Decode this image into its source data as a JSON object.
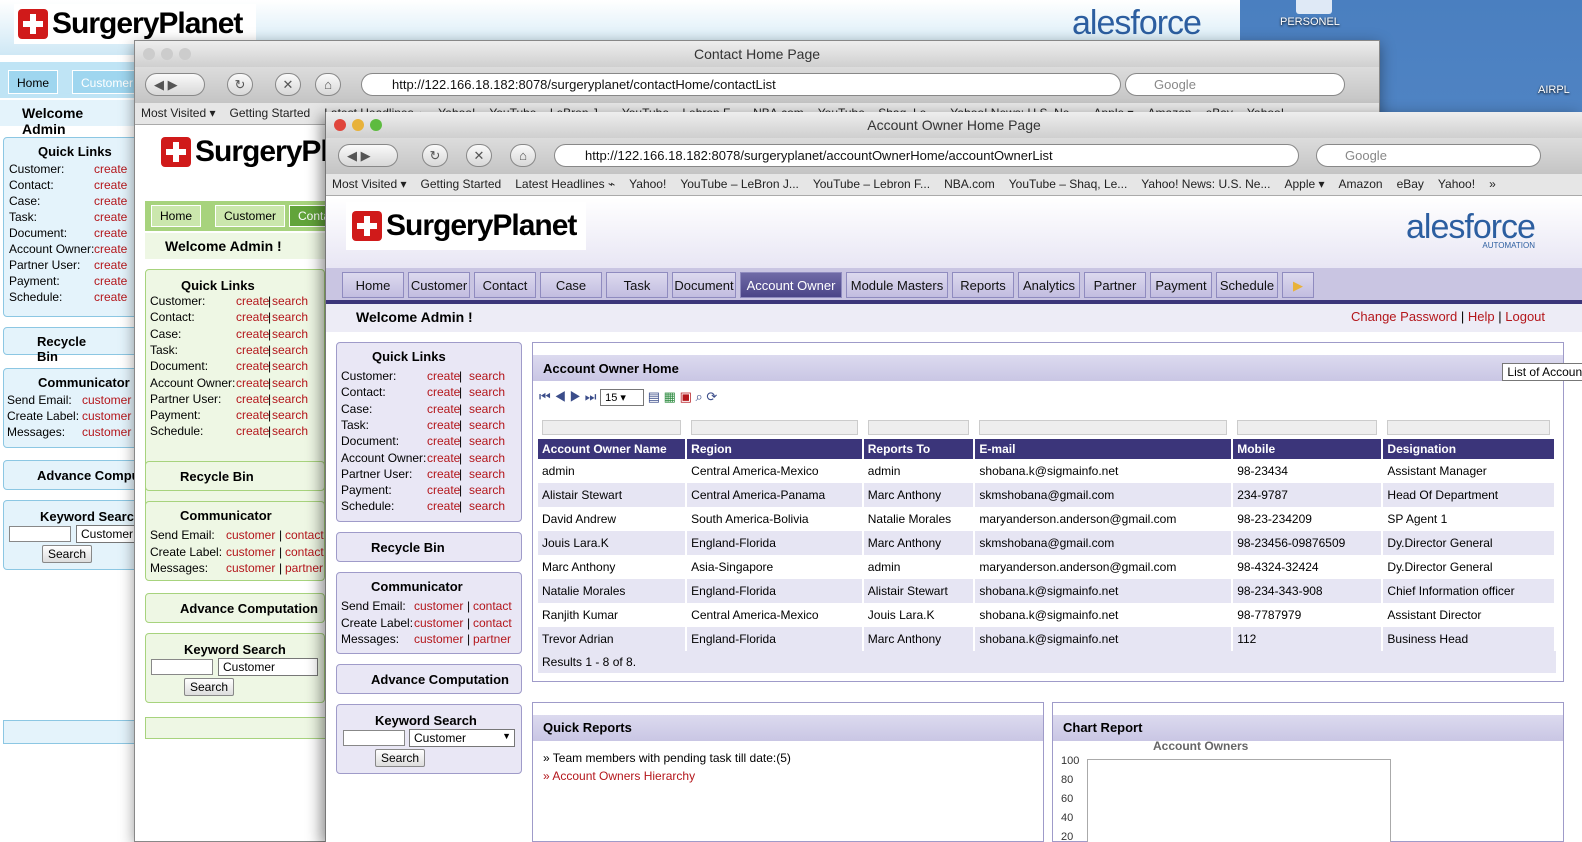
{
  "desktop": {
    "personel_label": "PERSONEL",
    "airport_label": "AIRPL"
  },
  "back_window": {
    "brand": "SurgeryPlanet",
    "sf_brand": "alesforce",
    "tabs": [
      "Home",
      "Customer"
    ],
    "welcome": "Welcome Admin",
    "quick_links_title": "Quick Links",
    "quick_links": [
      {
        "label": "Customer:",
        "action": "create"
      },
      {
        "label": "Contact:",
        "action": "create"
      },
      {
        "label": "Case:",
        "action": "create"
      },
      {
        "label": "Task:",
        "action": "create"
      },
      {
        "label": "Document:",
        "action": "create"
      },
      {
        "label": "Account Owner:",
        "action": "create"
      },
      {
        "label": "Partner User:",
        "action": "create"
      },
      {
        "label": "Payment:",
        "action": "create"
      },
      {
        "label": "Schedule:",
        "action": "create"
      }
    ],
    "recycle_bin": "Recycle Bin",
    "communicator_title": "Communicator",
    "communicator": [
      {
        "label": "Send Email:",
        "link": "customer"
      },
      {
        "label": "Create Label:",
        "link": "customer"
      },
      {
        "label": "Messages:",
        "link": "customer"
      }
    ],
    "advance": "Advance Comput",
    "keyword_title": "Keyword Search",
    "keyword_select": "Customer",
    "search_btn": "Search"
  },
  "mid_window": {
    "title": "Contact Home Page",
    "url": "http://122.166.18.182:8078/surgeryplanet/contactHome/contactList",
    "search_placeholder": "Google",
    "bookmarks": [
      "Most Visited ▾",
      "Getting Started",
      "Latest Headlines ⌁",
      "Yahoo!",
      "YouTube – LeBron J...",
      "YouTube – Lebron F...",
      "NBA.com",
      "YouTube – Shaq, Le...",
      "Yahoo! News: U.S. Ne...",
      "Apple ▾",
      "Amazon",
      "eBay",
      "Yahoo!"
    ],
    "brand": "SurgeryPla",
    "tabs": [
      "Home",
      "Customer",
      "Contac"
    ],
    "welcome": "Welcome Admin !",
    "quick_links_title": "Quick Links",
    "quick_links": [
      "Customer:",
      "Contact:",
      "Case:",
      "Task:",
      "Document:",
      "Account Owner:",
      "Partner User:",
      "Payment:",
      "Schedule:"
    ],
    "create": "create",
    "search": "search",
    "recycle_bin": "Recycle Bin",
    "communicator_title": "Communicator",
    "communicator": [
      {
        "label": "Send Email:",
        "a": "customer",
        "b": "contact"
      },
      {
        "label": "Create Label:",
        "a": "customer",
        "b": "contact"
      },
      {
        "label": "Messages:",
        "a": "customer",
        "b": "partner"
      }
    ],
    "advance": "Advance Computation",
    "keyword_title": "Keyword Search",
    "keyword_select": "Customer",
    "search_btn": "Search"
  },
  "main_window": {
    "title": "Account Owner Home Page",
    "url": "http://122.166.18.182:8078/surgeryplanet/accountOwnerHome/accountOwnerList",
    "search_placeholder": "Google",
    "bookmarks": [
      "Most Visited ▾",
      "Getting Started",
      "Latest Headlines ⌁",
      "Yahoo!",
      "YouTube – LeBron J...",
      "YouTube – Lebron F...",
      "NBA.com",
      "YouTube – Shaq, Le...",
      "Yahoo! News: U.S. Ne...",
      "Apple ▾",
      "Amazon",
      "eBay",
      "Yahoo!",
      "»"
    ],
    "brand": "SurgeryPlanet",
    "sf_brand": "alesforce",
    "sf_sub": "AUTOMATION",
    "tabs": [
      "Home",
      "Customer",
      "Contact",
      "Case",
      "Task",
      "Document",
      "Account Owner",
      "Module Masters",
      "Reports",
      "Analytics",
      "Partner",
      "Payment",
      "Schedule"
    ],
    "active_tab": "Account Owner",
    "welcome": "Welcome Admin !",
    "top_links": {
      "change_password": "Change Password",
      "help": "Help",
      "logout": "Logout",
      "sep": "|"
    },
    "quick_links_title": "Quick Links",
    "quick_links": [
      "Customer:",
      "Contact:",
      "Case:",
      "Task:",
      "Document:",
      "Account Owner:",
      "Partner User:",
      "Payment:",
      "Schedule:"
    ],
    "create": "create",
    "search": "search",
    "sep": "|",
    "recycle_bin": "Recycle Bin",
    "communicator_title": "Communicator",
    "communicator": [
      {
        "label": "Send Email:",
        "a": "customer",
        "b": "contact"
      },
      {
        "label": "Create Label:",
        "a": "customer",
        "b": "contact"
      },
      {
        "label": "Messages:",
        "a": "customer",
        "b": "partner"
      }
    ],
    "advance": "Advance Computation",
    "keyword_title": "Keyword Search",
    "keyword_select": "Customer",
    "search_btn": "Search",
    "grid_panel_title": "Account Owner Home",
    "list_select": "List of Account Owners",
    "page_size": "15",
    "columns": [
      "Account Owner Name",
      "Region",
      "Reports To",
      "E-mail",
      "Mobile",
      "Designation"
    ],
    "rows": [
      [
        "admin",
        "Central America-Mexico",
        "admin",
        "shobana.k@sigmainfo.net",
        "98-23434",
        "Assistant Manager"
      ],
      [
        "Alistair Stewart",
        "Central America-Panama",
        "Marc Anthony",
        "skmshobana@gmail.com",
        "234-9787",
        "Head Of Department"
      ],
      [
        "David Andrew",
        "South America-Bolivia",
        "Natalie Morales",
        "maryanderson.anderson@gmail.com",
        "98-23-234209",
        "SP Agent 1"
      ],
      [
        "Jouis Lara.K",
        "England-Florida",
        "Marc Anthony",
        "skmshobana@gmail.com",
        "98-23456-09876509",
        "Dy.Director General"
      ],
      [
        "Marc Anthony",
        "Asia-Singapore",
        "admin",
        "maryanderson.anderson@gmail.com",
        "98-4324-32424",
        "Dy.Director General"
      ],
      [
        "Natalie Morales",
        "England-Florida",
        "Alistair Stewart",
        "shobana.k@sigmainfo.net",
        "98-234-343-908",
        "Chief Information officer"
      ],
      [
        "Ranjith Kumar",
        "Central America-Mexico",
        "Jouis Lara.K",
        "shobana.k@sigmainfo.net",
        "98-7787979",
        "Assistant Director"
      ],
      [
        "Trevor Adrian",
        "England-Florida",
        "Marc Anthony",
        "shobana.k@sigmainfo.net",
        "112",
        "Business Head"
      ]
    ],
    "results": "Results 1 - 8 of 8.",
    "quick_reports_title": "Quick Reports",
    "quick_reports": [
      {
        "text": "» Team members with pending task till date:(5)",
        "link": false
      },
      {
        "text": "» Account Owners Hierarchy",
        "link": true
      }
    ],
    "chart_report_title": "Chart Report",
    "chart_title": "Account Owners",
    "chart_ticks": [
      "100",
      "80",
      "60",
      "40",
      "20"
    ]
  }
}
